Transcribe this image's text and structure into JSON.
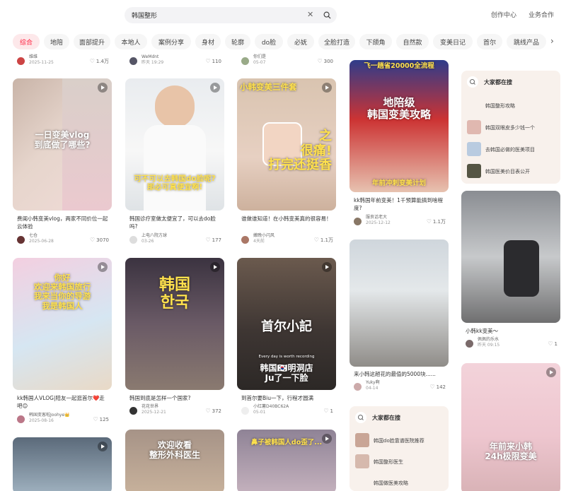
{
  "header": {
    "search_query": "韩国整形",
    "creator_center": "创作中心",
    "business": "业务合作"
  },
  "categories": [
    "综合",
    "地陪",
    "面部提升",
    "本地人",
    "案例分享",
    "身材",
    "轮廓",
    "do脸",
    "必妩",
    "全脸打造",
    "下颌角",
    "自然款",
    "变美日记",
    "首尔",
    "跳线产品"
  ],
  "top_row": [
    {
      "author": "维维",
      "date": "2025-11-25",
      "likes": "1.4万"
    },
    {
      "author": "WeMdnt",
      "date": "昨天 19:29",
      "likes": "110"
    },
    {
      "author": "你们是",
      "date": "05-07",
      "likes": "300"
    }
  ],
  "cards": [
    {
      "overlay": "一日变美vlog\n到底做了哪些?",
      "title": "费闺小韩变美vlog，两家不同价位一起云体验",
      "author": "七仓",
      "date": "2025-06-28",
      "likes": "3070"
    },
    {
      "overlay": "可不可以去韩国do脸呢?\n那必可真便宜啊!",
      "title": "韩国诊疗室做太便宜了，可以去do脸吗?",
      "author": "上电八院方球",
      "date": "03-26",
      "likes": "177"
    },
    {
      "overlay_top": "小韩变美三件套",
      "overlay": "之\n很痛!\n打完还挺香",
      "title": "谁做谁知道！在小韩变美真的很容易！",
      "author": "嫩晚小闪风",
      "date": "4天前",
      "likes": "1.1万"
    },
    {
      "overlay_top": "飞一趟省20000全流程",
      "overlay": "地陪级\n韩国变美攻略",
      "overlay_bottom": "年前冲刺变美计划",
      "title": "kk韩国年前变美！1千预算能搞到啥程度?",
      "author": "服良话老大",
      "date": "2025-12-12",
      "likes": "1.1万"
    },
    {
      "overlay": "你好\n欢迎来韩国旅行\n我来当你的导游\n我是韩国人",
      "title": "kk韩国人VLOG|陪友一起逛首尔❤️走吧😊",
      "author": "韩国变客啦Joohye👑",
      "date": "2025-08-16",
      "likes": "125"
    },
    {
      "overlay": "韩国\n한국",
      "title": "韩国到底是怎样一个国家?",
      "author": "花花世界",
      "date": "2025-12-21",
      "likes": "372"
    },
    {
      "overlay": "首尔小記",
      "overlay_sub": "Every day is worth recording",
      "overlay_bottom": "韩国🇰🇷明洞店\nJu了一下脸",
      "title": "到首尔要Biu一下，行程才圆满",
      "author": "小红薯D40BC62A",
      "date": "05-01",
      "likes": "1"
    },
    {
      "title": "来小韩这趟花的最值的5000块......",
      "author": "Yuky啊",
      "date": "04-14",
      "likes": "142"
    },
    {
      "title": "小韩kk变美～",
      "author": "佩佩的乐水",
      "date": "昨天 09:15",
      "likes": "1"
    },
    {
      "overlay": "欢迎收看\n整形外科医生"
    },
    {
      "overlay": "鼻子被韩国人do歪了..."
    },
    {
      "overlay": "年前来小韩\n24h极限变美"
    }
  ],
  "trending": [
    {
      "heading": "大家都在搜",
      "items": [
        "韩国整形攻略",
        "韩国双眼皮多少钱一个",
        "去韩国必做的医美项目",
        "韩国医美价目表公开"
      ]
    },
    {
      "heading": "大家都在搜",
      "items": [
        "韩国do脸靠谱医院推荐",
        "韩国整形医生",
        "韩国做医美攻略"
      ]
    }
  ],
  "colors": {
    "accent": "#ff2442",
    "active_pill_bg": "#fde8ea",
    "trend_bg": "#f8f1ec"
  }
}
